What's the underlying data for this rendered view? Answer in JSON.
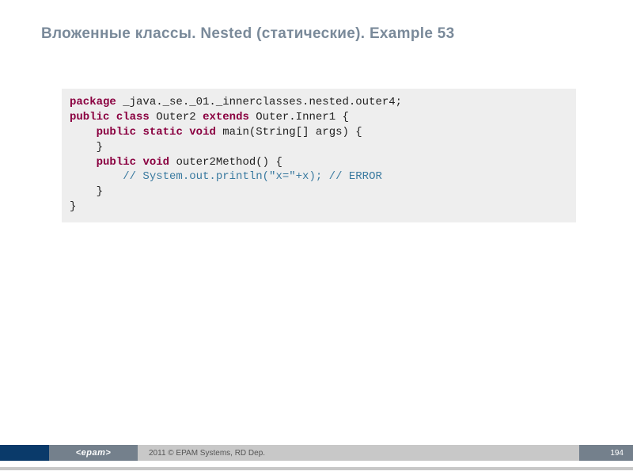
{
  "title": "Вложенные классы. Nested (статические). Example 53",
  "code": {
    "l1": {
      "kw1": "package",
      "rest": " _java._se._01._innerclasses.nested.outer4;"
    },
    "l2": {
      "kw1": "public",
      "kw2": "class",
      "t1": " Outer2 ",
      "kw3": "extends",
      "t2": " Outer.Inner1 {"
    },
    "l3": {
      "indent": "    ",
      "kw1": "public",
      "kw2": "static",
      "kw3": "void",
      "t1": " main(String[] args) {"
    },
    "l4": {
      "indent": "    ",
      "t1": "}"
    },
    "l5": {
      "indent": "    ",
      "kw1": "public",
      "kw2": "void",
      "t1": " outer2Method() {"
    },
    "l6": {
      "indent": "        ",
      "cm": "// System.out.println(\"x=\"+x); // ERROR"
    },
    "l7": {
      "indent": "    ",
      "t1": "}"
    },
    "l8": {
      "t1": "}"
    }
  },
  "footer": {
    "logo": "<epam>",
    "copyright": "2011 © EPAM Systems, RD Dep.",
    "page": "194"
  }
}
